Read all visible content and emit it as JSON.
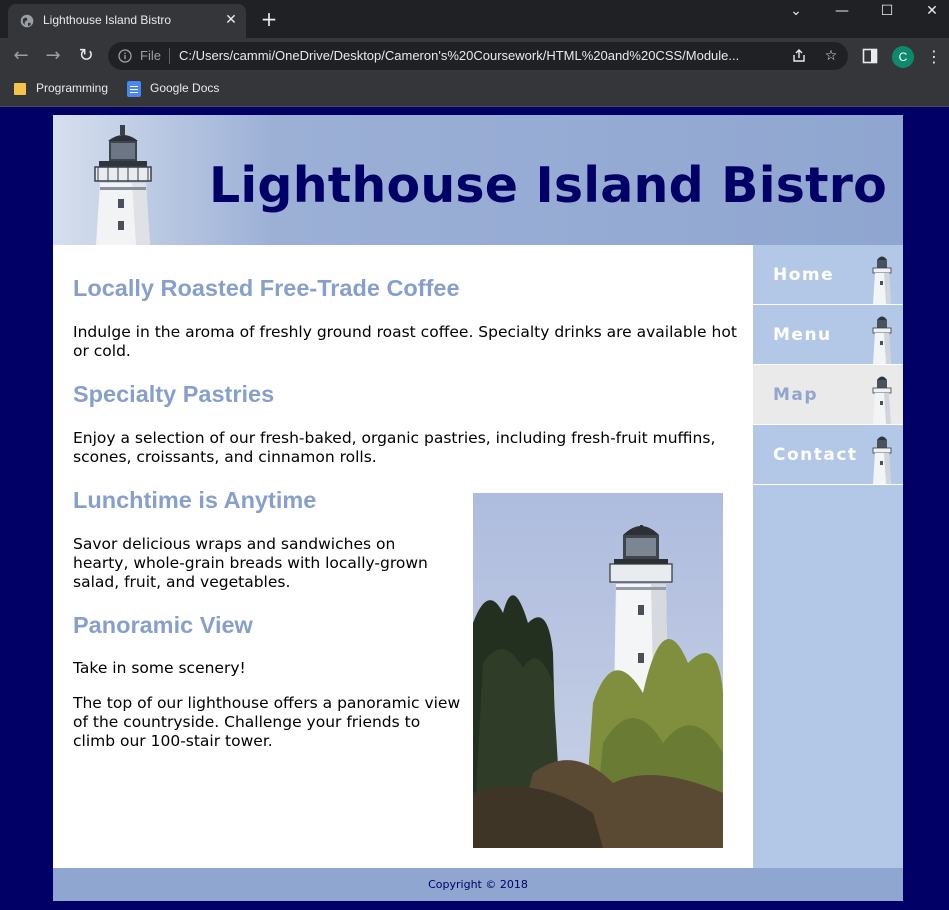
{
  "browser": {
    "tab_title": "Lighthouse Island Bistro",
    "tab_close": "✕",
    "new_tab": "+",
    "window_controls": {
      "dropdown": "⌄",
      "minimize": "—",
      "maximize": "☐",
      "close": "✕"
    },
    "toolbar": {
      "back": "←",
      "forward": "→",
      "reload": "↻",
      "file_label": "File",
      "url": "C:/Users/cammi/OneDrive/Desktop/Cameron's%20Coursework/HTML%20and%20CSS/Module...",
      "share_icon": "share-icon",
      "bookmark_star": "☆",
      "avatar_initial": "C",
      "menu": "⋮"
    },
    "bookmarks": [
      {
        "label": "Programming",
        "icon": "folder-icon"
      },
      {
        "label": "Google Docs",
        "icon": "google-docs-icon"
      }
    ]
  },
  "page": {
    "title": "Lighthouse Island Bistro",
    "nav": [
      {
        "label": "Home",
        "active": false
      },
      {
        "label": "Menu",
        "active": false
      },
      {
        "label": "Map",
        "active": true
      },
      {
        "label": "Contact",
        "active": false
      }
    ],
    "sections": [
      {
        "heading": "Locally Roasted Free-Trade Coffee",
        "paragraphs": [
          "Indulge in the aroma of freshly ground roast coffee. Specialty drinks are available hot or cold."
        ]
      },
      {
        "heading": "Specialty Pastries",
        "paragraphs": [
          "Enjoy a selection of our fresh-baked, organic pastries, including fresh-fruit muffins, scones, croissants, and cinnamon rolls."
        ]
      },
      {
        "heading": "Lunchtime is Anytime",
        "paragraphs": [
          "Savor delicious wraps and sandwiches on hearty, whole-grain breads with locally-grown salad, fruit, and vegetables."
        ]
      },
      {
        "heading": "Panoramic View",
        "paragraphs": [
          "Take in some scenery!",
          "The top of our lighthouse offers a panoramic view of the countryside. Challenge your friends to climb our 100-stair tower."
        ]
      }
    ],
    "footer": "Copyright © 2018"
  },
  "colors": {
    "page_background": "#000066",
    "title": "#000066",
    "heading": "#869fcb",
    "nav_background": "#b3c7e6",
    "nav_active": "#eaeaea",
    "header_footer": "#8fa6d0"
  }
}
